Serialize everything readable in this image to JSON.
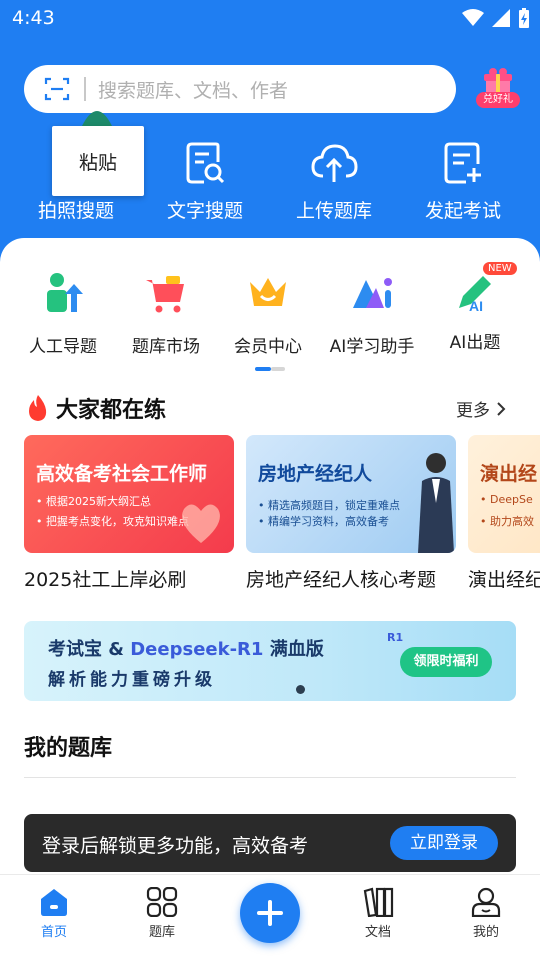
{
  "status_bar": {
    "time": "4:43"
  },
  "search": {
    "placeholder": "搜索题库、文档、作者"
  },
  "gift": {
    "label": "兑好礼"
  },
  "paste_popup": {
    "label": "粘贴"
  },
  "tools": [
    {
      "label": "拍照搜题",
      "icon": "camera-scan-icon"
    },
    {
      "label": "文字搜题",
      "icon": "doc-search-icon"
    },
    {
      "label": "上传题库",
      "icon": "cloud-upload-icon"
    },
    {
      "label": "发起考试",
      "icon": "doc-add-icon"
    }
  ],
  "quick": [
    {
      "label": "人工导题",
      "icon": "person-upload-icon"
    },
    {
      "label": "题库市场",
      "icon": "shopping-cart-icon"
    },
    {
      "label": "会员中心",
      "icon": "crown-icon"
    },
    {
      "label": "AI学习助手",
      "icon": "ai-assistant-icon"
    },
    {
      "label": "AI出题",
      "icon": "ai-pen-icon",
      "badge": "NEW"
    }
  ],
  "section_popular": {
    "title": "大家都在练",
    "more": "更多"
  },
  "cards": [
    {
      "title": "2025社工上岸必刷",
      "img_heading": "高效备考社会工作师",
      "img_lines": [
        "• 根据2025新大纲汇总",
        "• 把握考点变化，攻克知识难点"
      ]
    },
    {
      "title": "房地产经纪人核心考题",
      "img_heading": "房地产经纪人",
      "img_lines": [
        "• 精选高频题目，锁定重难点",
        "• 精编学习资料，高效备考"
      ]
    },
    {
      "title": "演出经纪",
      "img_heading": "演出经",
      "img_lines": [
        "• DeepSe",
        "• 助力高效"
      ]
    }
  ],
  "banner": {
    "brand": "考试宝 & ",
    "ds": "Deepseek-R1",
    "suffix": " 满血版",
    "line2": "解析能力重磅升级",
    "tag": "R1",
    "button": "领限时福利"
  },
  "my_library": {
    "title": "我的题库"
  },
  "login_bar": {
    "text": "登录后解锁更多功能，高效备考",
    "button": "立即登录"
  },
  "tabs": [
    {
      "label": "首页",
      "icon": "home-icon",
      "active": true
    },
    {
      "label": "题库",
      "icon": "grid-icon"
    },
    {
      "label": "文档",
      "icon": "books-icon"
    },
    {
      "label": "我的",
      "icon": "user-icon"
    }
  ],
  "colors": {
    "primary": "#1f7ef2",
    "accent_green": "#1fc486"
  }
}
